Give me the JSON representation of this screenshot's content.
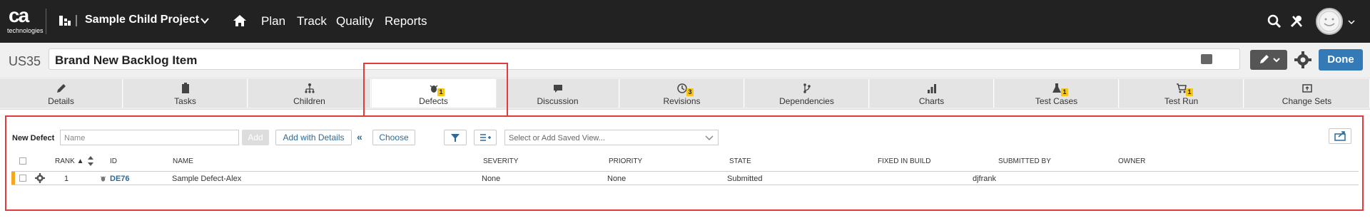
{
  "topbar": {
    "logo_text": "ca",
    "logo_subtext": "technologies",
    "project_name": "Sample Child Project",
    "nav": [
      "Plan",
      "Track",
      "Quality",
      "Reports"
    ],
    "icons": [
      "home-icon",
      "search-icon",
      "tools-icon",
      "avatar"
    ]
  },
  "header": {
    "item_id": "US35",
    "item_title": "Brand New Backlog Item",
    "done_label": "Done"
  },
  "tabs": [
    {
      "label": "Details",
      "icon": "pencil-icon",
      "badge": ""
    },
    {
      "label": "Tasks",
      "icon": "clipboard-icon",
      "badge": ""
    },
    {
      "label": "Children",
      "icon": "hierarchy-icon",
      "badge": ""
    },
    {
      "label": "Defects",
      "icon": "bug-icon",
      "badge": "1"
    },
    {
      "label": "Discussion",
      "icon": "speech-bubble-icon",
      "badge": ""
    },
    {
      "label": "Revisions",
      "icon": "history-icon",
      "badge": "3"
    },
    {
      "label": "Dependencies",
      "icon": "branch-icon",
      "badge": ""
    },
    {
      "label": "Charts",
      "icon": "bar-chart-icon",
      "badge": ""
    },
    {
      "label": "Test Cases",
      "icon": "flask-icon",
      "badge": "1"
    },
    {
      "label": "Test Run",
      "icon": "cart-icon",
      "badge": "1"
    },
    {
      "label": "Change Sets",
      "icon": "changeset-icon",
      "badge": ""
    }
  ],
  "toolbar": {
    "new_defect_label": "New Defect",
    "name_placeholder": "Name",
    "add_label": "Add",
    "add_details_label": "Add with Details",
    "collapse_glyph": "«",
    "choose_label": "Choose",
    "view_placeholder": "Select or Add Saved View..."
  },
  "grid": {
    "columns": [
      "RANK",
      "ID",
      "NAME",
      "SEVERITY",
      "PRIORITY",
      "STATE",
      "FIXED IN BUILD",
      "SUBMITTED BY",
      "OWNER"
    ],
    "rows": [
      {
        "rank": "1",
        "id": "DE76",
        "name": "Sample Defect-Alex",
        "severity": "None",
        "priority": "None",
        "state": "Submitted",
        "fixed_in_build": "",
        "submitted_by": "djfrank",
        "owner": ""
      }
    ]
  },
  "colors": {
    "topbar": "#222222",
    "accent": "#337ab7",
    "highlight": "#e23b3b",
    "badge": "#f5c518",
    "row_marker": "#f5a623"
  }
}
